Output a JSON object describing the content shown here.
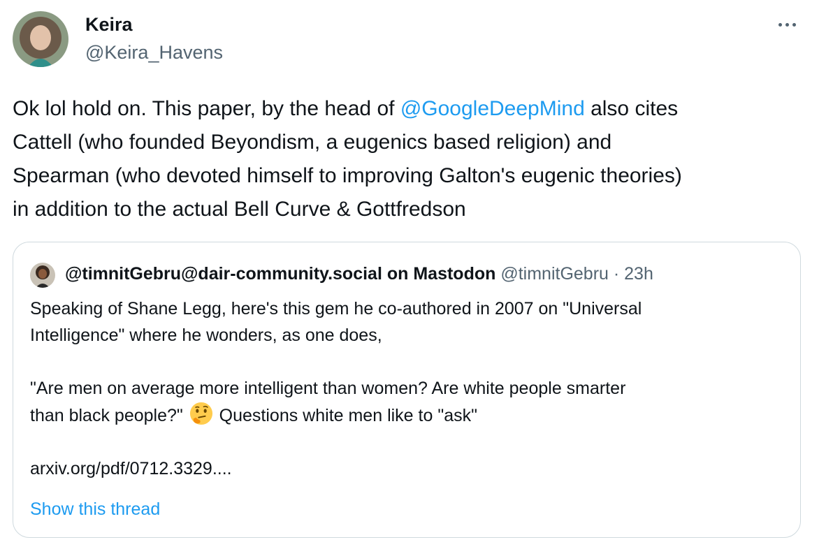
{
  "tweet": {
    "author_name": "Keira",
    "author_handle": "@Keira_Havens",
    "avatar_icon": "user-avatar",
    "more_icon": "more-options-icon",
    "text_segments": [
      "Ok lol hold on. This paper, by the head of ",
      "@GoogleDeepMind",
      " also cites\nCattell (who founded Beyondism, a eugenics based religion) and\nSpearman (who devoted himself to improving Galton's eugenic theories)\nin addition to the actual Bell Curve & Gottfredson"
    ]
  },
  "quote": {
    "author_name": "@timnitGebru@dair-community.social on Mastodon",
    "author_handle": "@timnitGebru",
    "separator": " · ",
    "time": "23h",
    "body_before_emoji": "Speaking of Shane Legg, here's this gem he co-authored in 2007 on \"Universal\nIntelligence\" where he wonders, as one does,\n\n\"Are men on average more intelligent than women? Are white people smarter\nthan black people?\"",
    "emoji_icon": "thinking-face-emoji",
    "body_after_emoji": "Questions white men like to \"ask\"\n\narxiv.org/pdf/0712.3329....",
    "show_thread": "Show this thread"
  },
  "colors": {
    "link": "#1d9bf0",
    "secondary_text": "#536471",
    "border": "#cfd9de"
  }
}
